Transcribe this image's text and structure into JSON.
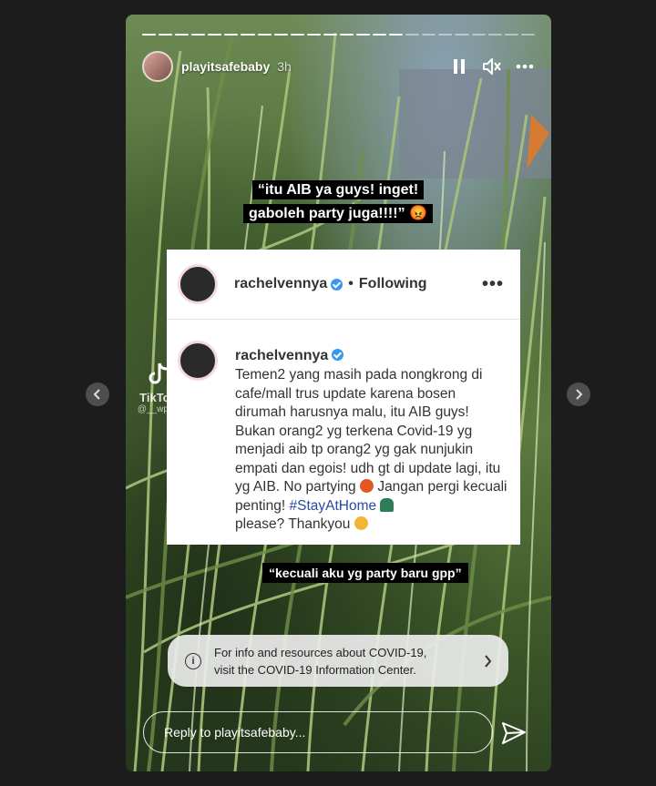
{
  "story": {
    "username": "playitsafebaby",
    "time_ago": "3h",
    "progress": {
      "segments": 24,
      "completed": 16
    }
  },
  "icons": {
    "pause": "pause-icon",
    "mute": "muted-speaker-icon",
    "more": "more-horizontal-icon",
    "info": "info-icon",
    "chevron": "chevron-right-icon",
    "send": "paper-plane-icon",
    "prev": "chevron-left-icon",
    "next": "chevron-right-icon"
  },
  "caption_top": "“itu AIB ya guys! inget! gaboleh party juga!!!!” 😡",
  "post": {
    "header_username": "rachelvennya",
    "header_status": "Following",
    "header_more": "•••",
    "author": "rachelvennya",
    "body_main": "Temen2 yang masih pada nongkrong di cafe/mall trus update karena bosen dirumah harusnya malu, itu AIB guys! Bukan orang2 yg terkena Covid-19 yg menjadi aib tp orang2 yg gak nunjukin empati dan egois! udh gt di update lagi, itu yg AIB. No partying",
    "body_mid": "Jangan pergi kecuali penting!",
    "hashtag": "#StayAtHome",
    "body_end": "please? Thankyou"
  },
  "watermark": {
    "name": "TikTok",
    "user": "@__wp__"
  },
  "caption_bottom": "“kecuali aku yg party baru gpp”",
  "covid_banner": {
    "line1": "For info and resources about COVID-19,",
    "line2": "visit the COVID-19 Information Center."
  },
  "reply": {
    "placeholder": "Reply to playitsafebaby..."
  },
  "colors": {
    "background": "#1c1c1c",
    "verified": "#3897f0",
    "hashtag": "#2b4aa6"
  }
}
